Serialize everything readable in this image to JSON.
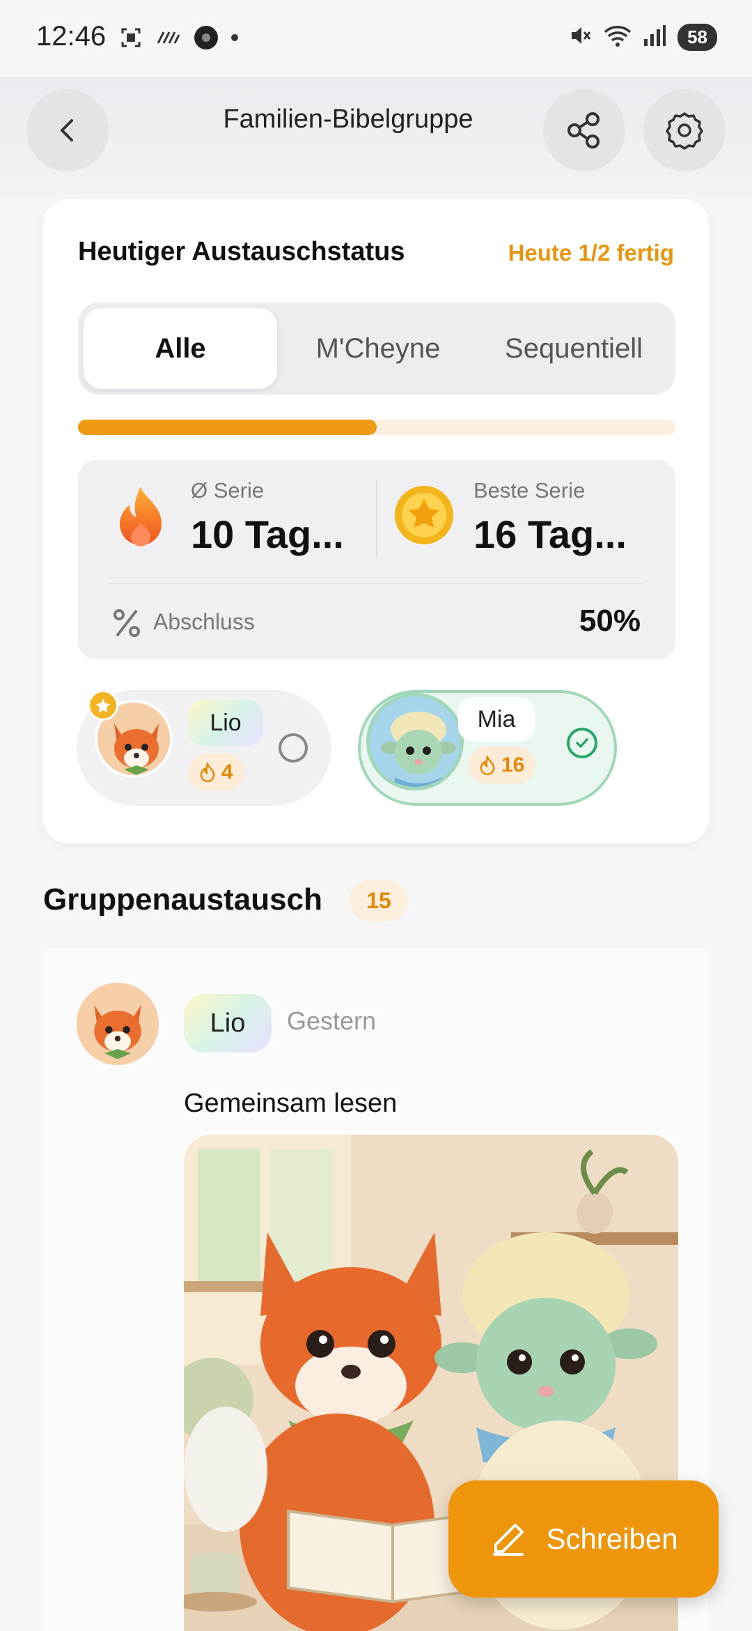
{
  "status_bar": {
    "time": "12:46",
    "battery": "58"
  },
  "header": {
    "title": "Familien-Bibelgruppe"
  },
  "status_card": {
    "title": "Heutiger Austauschstatus",
    "progress_text": "Heute 1/2 fertig",
    "progress_fraction": 0.5,
    "tabs": [
      {
        "label": "Alle",
        "active": true
      },
      {
        "label": "M'Cheyne",
        "active": false
      },
      {
        "label": "Sequentiell",
        "active": false
      }
    ],
    "stats": {
      "avg_streak_label": "Ø Serie",
      "avg_streak_value": "10 Tag...",
      "best_streak_label": "Beste Serie",
      "best_streak_value": "16 Tag...",
      "completion_label": "Abschluss",
      "completion_value": "50%"
    },
    "members": [
      {
        "name": "Lio",
        "streak": "4",
        "done": false
      },
      {
        "name": "Mia",
        "streak": "16",
        "done": true
      }
    ]
  },
  "group_exchange": {
    "title": "Gruppenaustausch",
    "count": "15",
    "posts": [
      {
        "author": "Lio",
        "time": "Gestern",
        "text": "Gemeinsam lesen"
      }
    ]
  },
  "fab": {
    "label": "Schreiben"
  },
  "colors": {
    "accent": "#ee950c",
    "success": "#2aa46b"
  }
}
